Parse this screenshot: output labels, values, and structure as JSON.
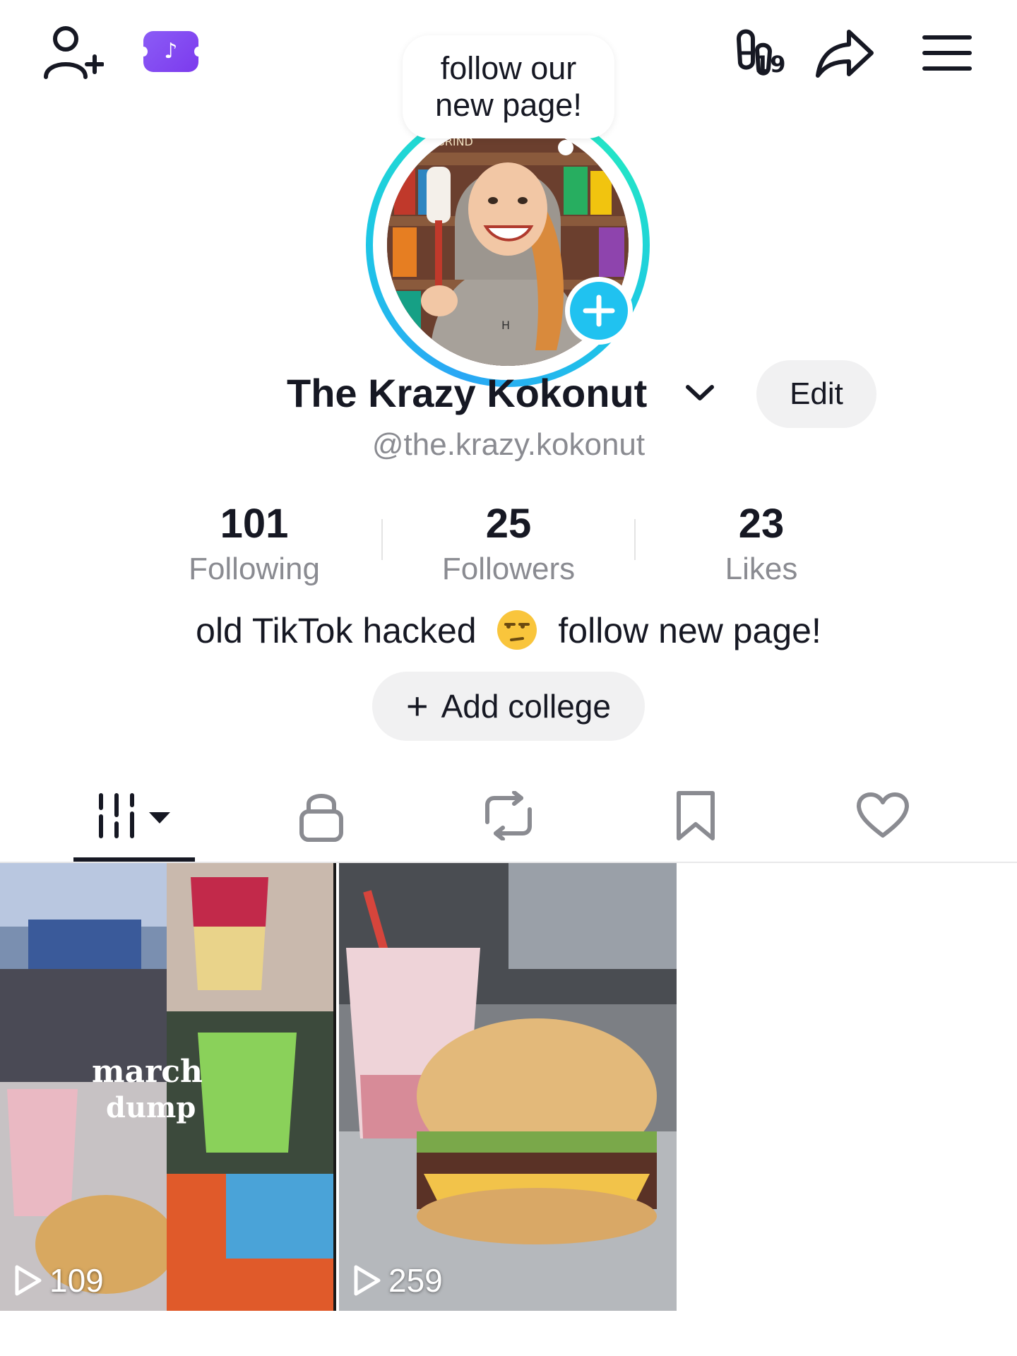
{
  "header": {
    "add_friend_icon": "person-plus-icon",
    "ticket_icon": "tiktok-ticket-icon",
    "ticket_glyph": "♪",
    "footprint_icon": "footprints-icon",
    "footprint_count": "19",
    "share_icon": "share-arrow-icon",
    "menu_icon": "hamburger-menu-icon"
  },
  "avatar": {
    "bubble_line1": "follow our",
    "bubble_line2": "new page!",
    "image_sign_text": "DAILY GRIND",
    "ring_colors": [
      "#2aa7f5",
      "#22e3c8"
    ],
    "plus_color": "#20c2f0"
  },
  "profile": {
    "display_name": "The Krazy Kokonut",
    "handle": "@the.krazy.kokonut",
    "edit_label": "Edit",
    "stats": [
      {
        "value": "101",
        "label": "Following"
      },
      {
        "value": "25",
        "label": "Followers"
      },
      {
        "value": "23",
        "label": "Likes"
      }
    ],
    "bio_before": "old TikTok hacked",
    "bio_emoji": "unamused-face-emoji",
    "bio_after": "follow new page!",
    "add_college_label": "Add college",
    "add_college_icon": "+"
  },
  "tabs": [
    {
      "icon": "videos-grid-icon",
      "active": true
    },
    {
      "icon": "lock-icon",
      "active": false
    },
    {
      "icon": "repost-icon",
      "active": false
    },
    {
      "icon": "bookmark-icon",
      "active": false
    },
    {
      "icon": "heart-icon",
      "active": false
    }
  ],
  "videos": [
    {
      "views": "109",
      "overlay_line1": "march",
      "overlay_line2": "dump"
    },
    {
      "views": "259"
    }
  ]
}
